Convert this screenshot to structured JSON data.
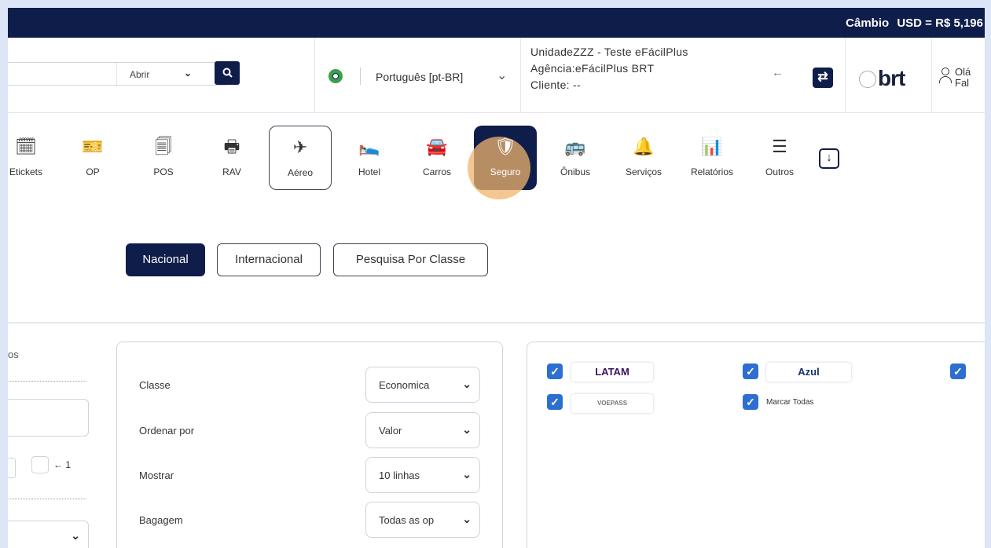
{
  "topbar": {
    "cambio_label": "Câmbio",
    "rate": "USD = R$ 5,196"
  },
  "header": {
    "search_select": "Abrir",
    "language": "Português [pt-BR]",
    "agency_unit": "UnidadeZZZ - Teste eFácilPlus",
    "agency_name": "Agência:eFácilPlus BRT",
    "client": "Cliente: --",
    "logo_text": "brt",
    "user_line1": "Olá",
    "user_line2": "Fal"
  },
  "modules": [
    {
      "label": "Etickets",
      "icon": "ticket-calendar-icon"
    },
    {
      "label": "OP",
      "icon": "ticket-icon"
    },
    {
      "label": "POS",
      "icon": "pos-icon"
    },
    {
      "label": "RAV",
      "icon": "receipt-icon"
    },
    {
      "label": "Aéreo",
      "icon": "airplane-icon"
    },
    {
      "label": "Hotel",
      "icon": "bed-icon"
    },
    {
      "label": "Carros",
      "icon": "car-icon"
    },
    {
      "label": "Seguro",
      "icon": "shield-icon"
    },
    {
      "label": "Ônibus",
      "icon": "bus-icon"
    },
    {
      "label": "Serviços",
      "icon": "bell-icon"
    },
    {
      "label": "Relatórios",
      "icon": "report-icon"
    },
    {
      "label": "Outros",
      "icon": "stack-icon"
    }
  ],
  "tabs": [
    "Nacional",
    "Internacional",
    "Pesquisa Por Classe"
  ],
  "left_panel": {
    "title_fragment": "os",
    "counter": "1"
  },
  "filters": [
    {
      "label": "Classe",
      "value": "Economica"
    },
    {
      "label": "Ordenar por",
      "value": "Valor"
    },
    {
      "label": "Mostrar",
      "value": "10 linhas"
    },
    {
      "label": "Bagagem",
      "value": "Todas as op"
    }
  ],
  "airlines": {
    "latam": "LATAM",
    "azul": "Azul",
    "voepass": "VOEPASS",
    "marcar_todas": "Marcar Todas"
  },
  "colors": {
    "navy": "#0f1d4a",
    "checkbox": "#2d6fd0",
    "highlight": "#f0b46e"
  }
}
